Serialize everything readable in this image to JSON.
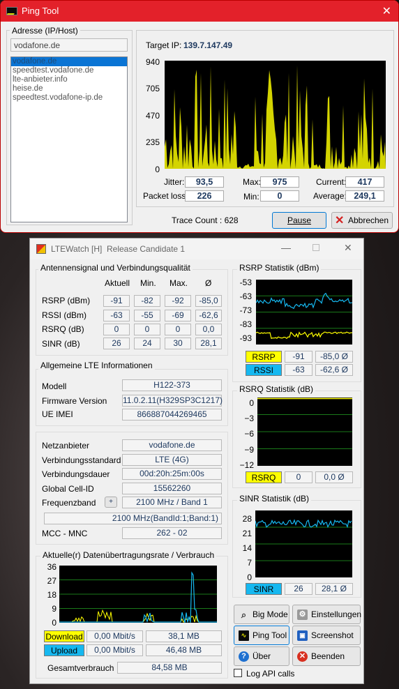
{
  "ping": {
    "title": "Ping Tool",
    "close": "✕",
    "address_group": "Adresse (IP/Host)",
    "address_value": "vodafone.de",
    "hosts": [
      "vodafone.de",
      "speedtest.vodafone.de",
      "lte-anbieter.info",
      "heise.de",
      "speedtest.vodafone-ip.de"
    ],
    "target_label": "Target IP:",
    "target_ip": "139.7.147.49",
    "y_ticks": [
      "940",
      "705",
      "470",
      "235",
      "0"
    ],
    "jitter_label": "Jitter:",
    "jitter": "93,5",
    "max_label": "Max:",
    "max": "975",
    "current_label": "Current:",
    "current": "417",
    "loss_label": "Packet loss:",
    "loss": "226",
    "min_label": "Min:",
    "min": "0",
    "avg_label": "Average:",
    "avg": "249,1",
    "trace_count": "Trace Count : 628",
    "pause": "Pause",
    "cancel": "Abbrechen",
    "graph_color": "#d4d400"
  },
  "lte": {
    "title": "LTEWatch [H]",
    "subtitle": "Release Candidate 1",
    "signal_group": "Antennensignal und Verbindungsqualität",
    "col_headers": [
      "Aktuell",
      "Min.",
      "Max.",
      "Ø"
    ],
    "rows": [
      {
        "label": "RSRP (dBm)",
        "vals": [
          "-91",
          "-82",
          "-92",
          "-85,0"
        ]
      },
      {
        "label": "RSSI (dBm)",
        "vals": [
          "-63",
          "-55",
          "-69",
          "-62,6"
        ]
      },
      {
        "label": "RSRQ (dB)",
        "vals": [
          "0",
          "0",
          "0",
          "0,0"
        ]
      },
      {
        "label": "SINR (dB)",
        "vals": [
          "26",
          "24",
          "30",
          "28,1"
        ]
      }
    ],
    "info_group": "Allgemeine LTE Informationen",
    "model_label": "Modell",
    "model": "H122-373",
    "fw_label": "Firmware Version",
    "fw": "11.0.2.11(H329SP3C1217)",
    "imei_label": "UE IMEI",
    "imei": "866887044269465",
    "provider_label": "Netzanbieter",
    "provider": "vodafone.de",
    "standard_label": "Verbindungsstandard",
    "standard": "LTE (4G)",
    "duration_label": "Verbindungsdauer",
    "duration": "00d:20h:25m:00s",
    "cellid_label": "Global Cell-ID",
    "cellid": "15562260",
    "band_label": "Frequenzband",
    "band_plus": "+",
    "band": "2100 MHz / Band 1",
    "band_detail": "2100 MHz(BandId:1;Band:1)",
    "mcc_label": "MCC - MNC",
    "mcc": "262 - 02",
    "rate_group": "Aktuelle(r) Datenübertragungsrate / Verbrauch",
    "rate_ticks": [
      "36",
      "27",
      "18",
      "9",
      "0"
    ],
    "download_label": "Download",
    "download_rate": "0,00 Mbit/s",
    "download_total": "38,1 MB",
    "upload_label": "Upload",
    "upload_rate": "0,00 Mbit/s",
    "upload_total": "46,48 MB",
    "total_label": "Gesamtverbrauch",
    "total": "84,58 MB",
    "rsrp_group": "RSRP Statistik (dBm)",
    "rsrp_ticks": [
      "-53",
      "-63",
      "-73",
      "-83",
      "-93"
    ],
    "rsrp_tag": "RSRP",
    "rsrp_cur": "-91",
    "rsrp_avg": "-85,0 Ø",
    "rssi_tag": "RSSI",
    "rssi_cur": "-63",
    "rssi_avg": "-62,6 Ø",
    "rsrq_group": "RSRQ Statistik (dB)",
    "rsrq_ticks": [
      "0",
      "−3",
      "−6",
      "−9",
      "−12"
    ],
    "rsrq_tag": "RSRQ",
    "rsrq_cur": "0",
    "rsrq_avg": "0,0 Ø",
    "sinr_group": "SINR Statistik (dB)",
    "sinr_ticks": [
      "28",
      "21",
      "14",
      "7",
      "0"
    ],
    "sinr_tag": "SINR",
    "sinr_cur": "26",
    "sinr_avg": "28,1 Ø",
    "btn_bigmode": "Big Mode",
    "btn_settings": "Einstellungen",
    "btn_ping": "Ping Tool",
    "btn_screenshot": "Screenshot",
    "btn_about": "Über",
    "btn_quit": "Beenden",
    "log_label": "Log API calls",
    "colors": {
      "yellow": "#ffff00",
      "cyan": "#16b8f0",
      "grid": "#1a7a1a"
    }
  }
}
